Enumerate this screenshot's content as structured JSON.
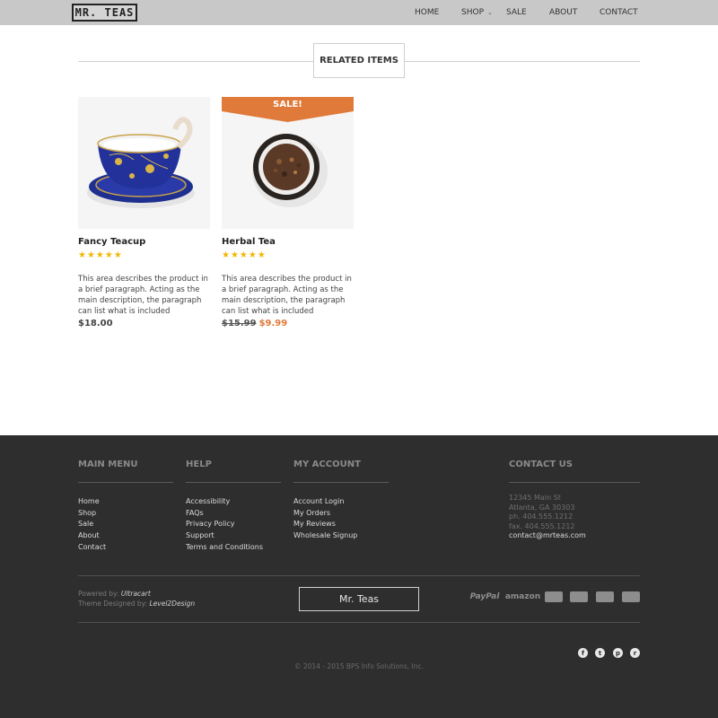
{
  "header": {
    "logo_text": "MR. TEAS",
    "nav": {
      "home": "HOME",
      "shop": "SHOP",
      "sale": "SALE",
      "about": "ABOUT",
      "contact": "CONTACT"
    }
  },
  "related": {
    "heading": "RELATED ITEMS"
  },
  "products": [
    {
      "title": "Fancy Teacup",
      "rating": 5,
      "stars": "★★★★★",
      "description": "This area describes the product in a brief paragraph. Acting as the main description, the paragraph can list what is included",
      "price": "$18.00"
    },
    {
      "title": "Herbal Tea",
      "badge": "SALE!",
      "rating": 4.5,
      "stars": "★★★★★",
      "description": "This area describes the product in a brief paragraph. Acting as the main description, the paragraph can list what is included",
      "old_price": "$15.99",
      "sale_price": "$9.99"
    }
  ],
  "footer": {
    "main_menu": {
      "heading": "MAIN MENU",
      "links": [
        "Home",
        "Shop",
        "Sale",
        "About",
        "Contact"
      ]
    },
    "help": {
      "heading": "HELP",
      "links": [
        "Accessibility",
        "FAQs",
        "Privacy Policy",
        "Support",
        "Terms and Conditions"
      ]
    },
    "my_account": {
      "heading": "MY ACCOUNT",
      "links": [
        "Account Login",
        "My Orders",
        "My Reviews",
        "Wholesale Signup"
      ]
    },
    "contact_us": {
      "heading": "CONTACT US",
      "address1": "12345 Main St",
      "address2": "Atlanta, GA 30303",
      "phone": "ph. 404.555.1212",
      "fax": "fax. 404.555.1212",
      "email": "contact@mrteas.com"
    },
    "powered_label": "Powered by:",
    "powered_by": "Ultracart",
    "theme_label": "Theme Designed by:",
    "theme_by": "Level2Design",
    "brand_box": "Mr. Teas",
    "payments": {
      "paypal": "PayPal",
      "amazon": "amazon"
    },
    "payment_icons": [
      "visa-card-icon",
      "mastercard-icon",
      "discover-card-icon",
      "amex-card-icon"
    ],
    "social_icons": [
      "facebook-icon",
      "twitter-icon",
      "pinterest-icon",
      "rss-icon"
    ],
    "copyright": "© 2014 - 2015 BPS Info Solutions, Inc."
  },
  "colors": {
    "header_bg": "#c8c8c8",
    "footer_bg": "#2e2e2e",
    "sale_accent": "#e07a3a",
    "star": "#f2b705"
  }
}
